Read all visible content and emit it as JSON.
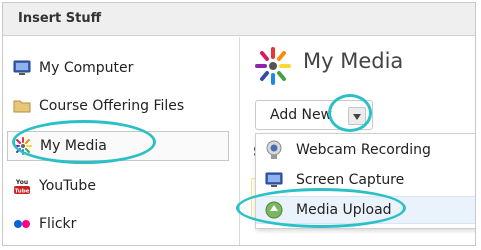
{
  "dialog": {
    "title": "Insert Stuff"
  },
  "sidebar": {
    "items": [
      {
        "label": "My Computer",
        "icon": "monitor-icon"
      },
      {
        "label": "Course Offering Files",
        "icon": "folder-icon"
      },
      {
        "label": "My Media",
        "icon": "kaltura-media-icon"
      },
      {
        "label": "YouTube",
        "icon": "youtube-icon"
      },
      {
        "label": "Flickr",
        "icon": "flickr-icon"
      }
    ],
    "selected_index": 2
  },
  "main": {
    "title": "My Media",
    "add_new_label": "Add New",
    "partial_label": "S",
    "menu": [
      {
        "label": "Webcam Recording",
        "icon": "webcam-icon"
      },
      {
        "label": "Screen Capture",
        "icon": "monitor-icon"
      },
      {
        "label": "Media Upload",
        "icon": "upload-icon"
      }
    ]
  },
  "colors": {
    "highlight": "#2bc0c5",
    "flickr_pink": "#ff0084",
    "flickr_blue": "#0063dc",
    "youtube_red": "#cc2020"
  }
}
